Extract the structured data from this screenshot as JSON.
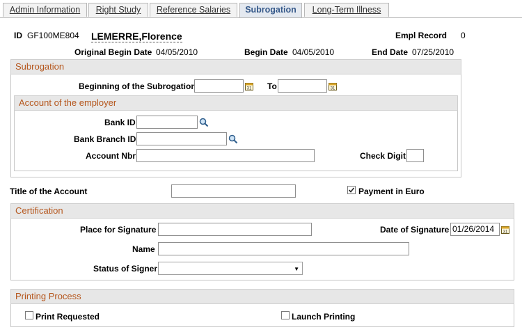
{
  "tabs": [
    {
      "label": "Admin Information"
    },
    {
      "label": "Right Study"
    },
    {
      "label": "Reference Salaries"
    },
    {
      "label": "Subrogation"
    },
    {
      "label": "Long-Term Illness"
    }
  ],
  "header": {
    "id_label": "ID",
    "id_value": "GF100ME804",
    "name": "LEMERRE,Florence",
    "empl_record_label": "Empl Record",
    "empl_record_value": "0",
    "original_begin_label": "Original Begin Date",
    "original_begin_value": "04/05/2010",
    "begin_label": "Begin Date",
    "begin_value": "04/05/2010",
    "end_label": "End Date",
    "end_value": "07/25/2010"
  },
  "subrogation": {
    "title": "Subrogation",
    "beginning_label": "Beginning of the Subrogation",
    "beginning_value": "",
    "to_label": "To",
    "to_value": ""
  },
  "employer_account": {
    "title": "Account of the employer",
    "bank_id_label": "Bank ID",
    "bank_id_value": "",
    "bank_branch_label": "Bank Branch ID",
    "bank_branch_value": "",
    "account_nbr_label": "Account Nbr",
    "account_nbr_value": "",
    "check_digit_label": "Check Digit",
    "check_digit_value": ""
  },
  "account": {
    "title_label": "Title of the Account",
    "title_value": "",
    "payment_euro_label": "Payment in Euro",
    "payment_euro_checked": true
  },
  "certification": {
    "title": "Certification",
    "place_label": "Place for Signature",
    "place_value": "",
    "date_label": "Date of Signature",
    "date_value": "01/26/2014",
    "name_label": "Name",
    "name_value": "",
    "status_label": "Status of Signer",
    "status_value": ""
  },
  "printing": {
    "title": "Printing Process",
    "print_requested_label": "Print Requested",
    "print_requested_checked": false,
    "launch_printing_label": "Launch Printing",
    "launch_printing_checked": false
  },
  "colors": {
    "section_title": "#b5561c",
    "tab_active": "#36598a",
    "section_bg": "#e7e7e7"
  },
  "icons": [
    "calendar-icon",
    "lookup-magnifier-icon",
    "checkbox",
    "dropdown-arrow"
  ]
}
